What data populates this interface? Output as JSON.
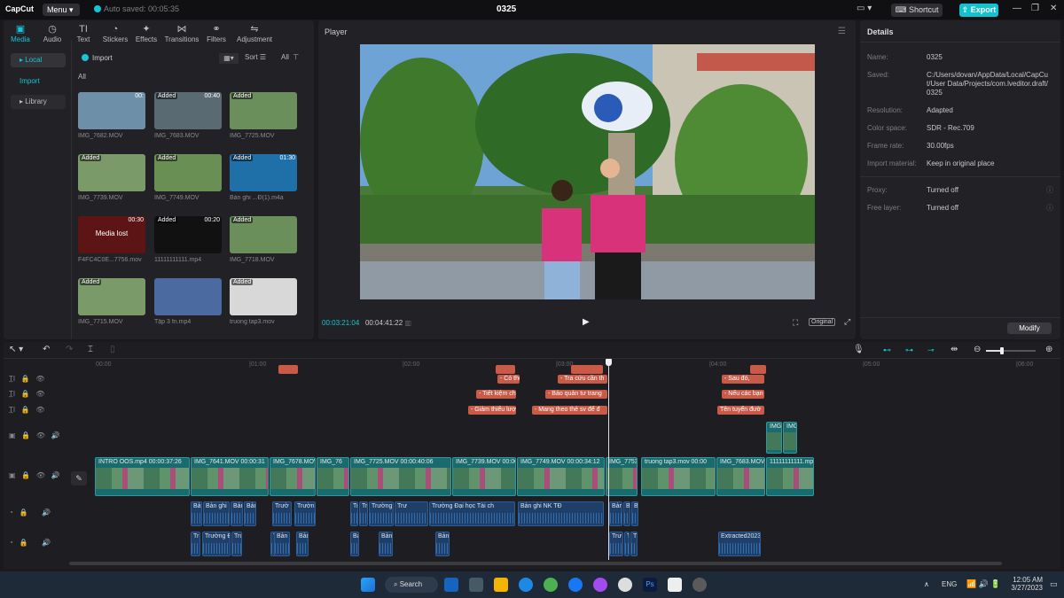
{
  "titlebar": {
    "logo": "CapCut",
    "menu": "Menu",
    "autosave": "Auto saved: 00:05:35",
    "project": "0325",
    "shortcut": "Shortcut",
    "export": "Export"
  },
  "toolbar": {
    "tabs": [
      "Media",
      "Audio",
      "Text",
      "Stickers",
      "Effects",
      "Transitions",
      "Filters",
      "Adjustment"
    ]
  },
  "media": {
    "sidebar": [
      "Local",
      "Import",
      "Library"
    ],
    "import_label": "Import",
    "sort_label": "Sort",
    "all_filter": "All",
    "all_heading": "All",
    "items": [
      {
        "badge": "",
        "dur": "00:",
        "label": "IMG_7682.MOV"
      },
      {
        "badge": "Added",
        "dur": "00:40",
        "label": "IMG_7683.MOV"
      },
      {
        "badge": "Added",
        "dur": "",
        "label": "IMG_7725.MOV"
      },
      {
        "badge": "Added",
        "dur": "",
        "label": "IMG_7739.MOV"
      },
      {
        "badge": "Added",
        "dur": "",
        "label": "IMG_7749.MOV"
      },
      {
        "badge": "Added",
        "dur": "01:30",
        "label": "Bản ghi ...Đ(1).m4a"
      },
      {
        "badge": "",
        "dur": "00:30",
        "label": "F4FC4C0E...7756.mov",
        "center": "Media lost"
      },
      {
        "badge": "Added",
        "dur": "00:20",
        "label": "11111111111.mp4"
      },
      {
        "badge": "Added",
        "dur": "",
        "label": "IMG_7718.MOV"
      },
      {
        "badge": "Added",
        "dur": "",
        "label": "IMG_7715.MOV"
      },
      {
        "badge": "",
        "dur": "",
        "label": "Tập 3 fn.mp4"
      },
      {
        "badge": "Added",
        "dur": "",
        "label": "truong tap3.mov"
      }
    ]
  },
  "player": {
    "title": "Player",
    "current": "00:03:21:04",
    "total": "00:04:41:22",
    "original": "Original"
  },
  "details": {
    "title": "Details",
    "rows": [
      {
        "k": "Name:",
        "v": "0325"
      },
      {
        "k": "Saved:",
        "v": "C:/Users/dovan/AppData/Local/CapCut/User Data/Projects/com.lveditor.draft/0325"
      },
      {
        "k": "Resolution:",
        "v": "Adapted"
      },
      {
        "k": "Color space:",
        "v": "SDR - Rec.709"
      },
      {
        "k": "Frame rate:",
        "v": "30.00fps"
      },
      {
        "k": "Import material:",
        "v": "Keep in original place"
      },
      {
        "k": "Proxy:",
        "v": "Turned off"
      },
      {
        "k": "Free layer:",
        "v": "Turned off"
      }
    ],
    "modify": "Modify"
  },
  "timeline": {
    "ruler": [
      "00:00",
      "|01:00",
      "|02:00",
      "|03:00",
      "|04:00",
      "|05:00",
      "|06:00"
    ],
    "text_clips": [
      {
        "t": "- Có thên",
        "row": 1
      },
      {
        "t": "- Tra cứu cần th",
        "row": 1
      },
      {
        "t": "- Sau đó,",
        "row": 1
      },
      {
        "t": "- Tiết kiệm ch",
        "row": 2
      },
      {
        "t": "- Bảo quản tư trang",
        "row": 2
      },
      {
        "t": "- Nếu các bạn",
        "row": 2
      },
      {
        "t": "- Giảm thiểu lượ",
        "row": 3
      },
      {
        "t": "- Mang theo thẻ sv để đ",
        "row": 3
      },
      {
        "t": "Tên tuyển đườ",
        "row": 3
      }
    ],
    "video_clips": [
      "INTRO OOS.mp4   00:00:37:26",
      "IMG_7641.MOV  00:00:31",
      "IMG_7678.MOV",
      "IMG_76",
      "IMG_7725.MOV  00:00:40:06",
      "IMG_7739.MOV  00:00",
      "IMG_7749.MOV  00:00:34:12",
      "IMG_7753",
      "truong tap3.mov  00:00",
      "IMG_7683.MOV",
      "11111111111.mp"
    ],
    "overlay_clips": [
      "IMG",
      "IMG"
    ],
    "audio1": [
      "Bả",
      "Bản ghi I",
      "Bản",
      "Bản",
      "Trườ",
      "Trườn",
      "Tr",
      "Trư",
      "Trường Đại họ",
      "Trư",
      "Trường Đại học Tài ch",
      "Bản ghi NK TĐ",
      "Bản",
      "B",
      "Bả"
    ],
    "audio2": [
      "Tr",
      "Trường Đ",
      "Trư",
      "Tr",
      "Bản",
      "Bản",
      "Bả",
      "Bản",
      "Bản",
      "Trư",
      "Tr",
      "Trư",
      "Extracted2023"
    ]
  },
  "taskbar": {
    "search": "Search",
    "lang": "ENG",
    "time": "12:05 AM",
    "date": "3/27/2023"
  }
}
